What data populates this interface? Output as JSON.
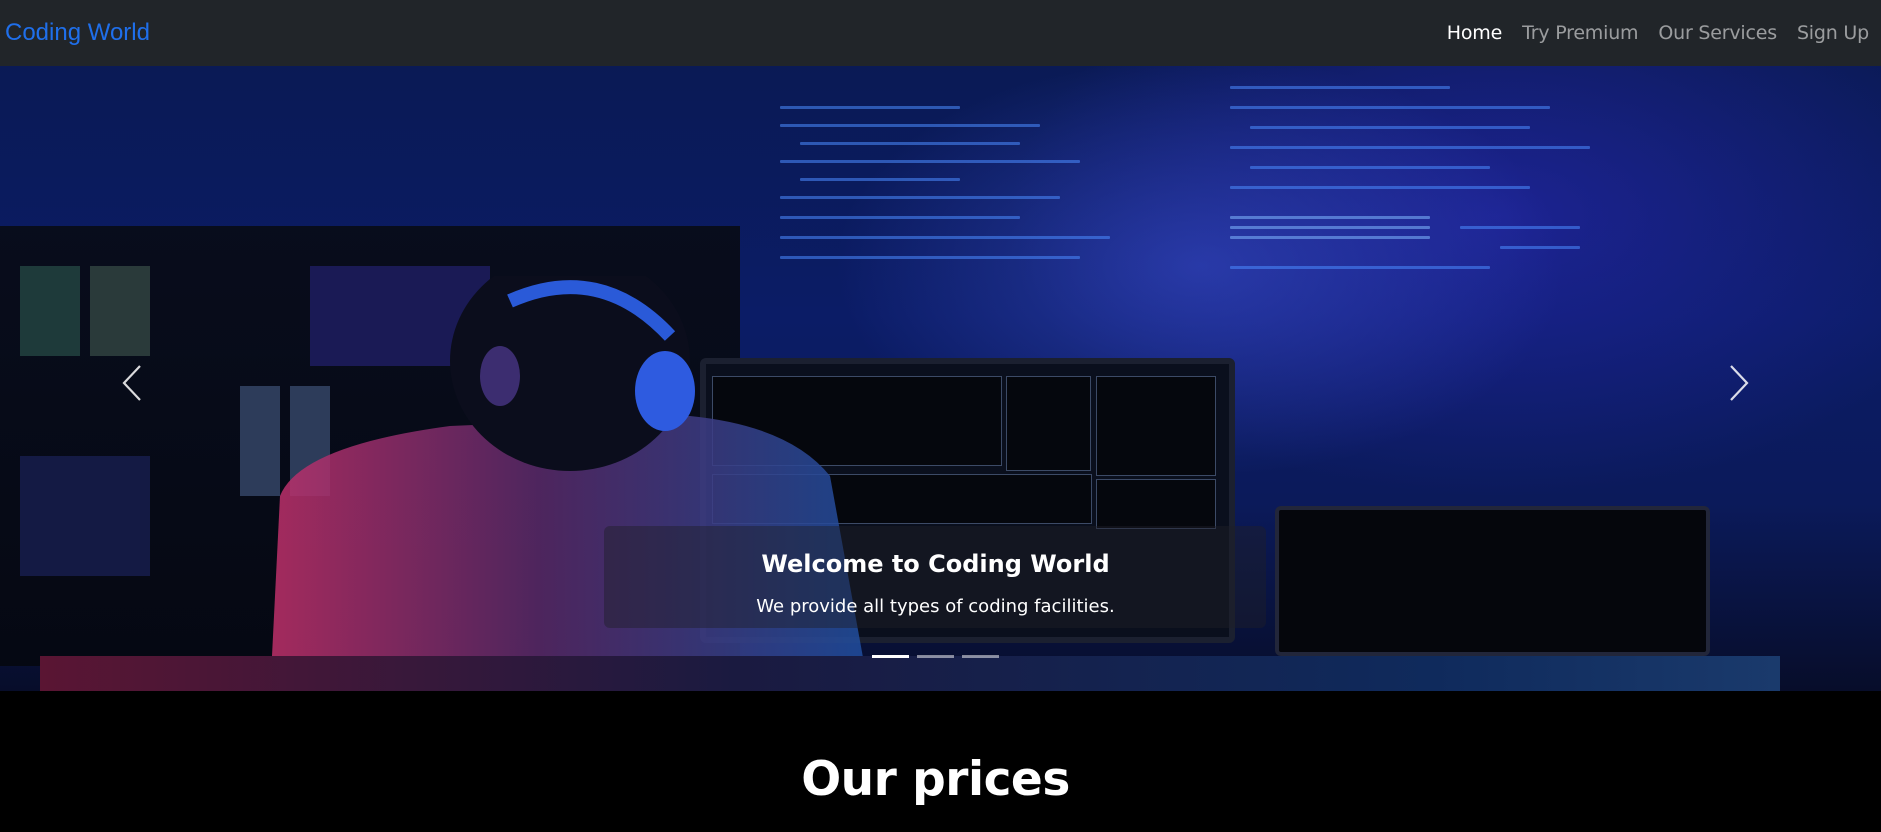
{
  "navbar": {
    "brand": "Coding World",
    "links": [
      {
        "label": "Home",
        "active": true
      },
      {
        "label": "Try Premium",
        "active": false
      },
      {
        "label": "Our Services",
        "active": false
      },
      {
        "label": "Sign Up",
        "active": false
      }
    ],
    "brand_color": "#1f6feb",
    "background": "#212529"
  },
  "carousel": {
    "caption_title": "Welcome to Coding World",
    "caption_text": "We provide all types of coding facilities.",
    "prev_icon": "chevron-left-icon",
    "next_icon": "chevron-right-icon",
    "slide_count": 3,
    "active_slide": 1
  },
  "prices_section": {
    "title": "Our prices"
  }
}
